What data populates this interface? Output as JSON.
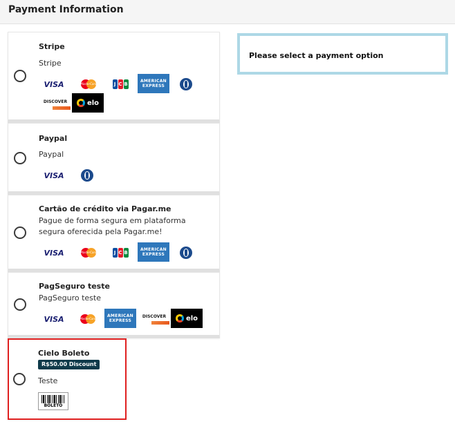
{
  "header": {
    "title": "Payment Information"
  },
  "selection_prompt": "Please select a payment option",
  "brands": {
    "visa": "VISA",
    "mastercard": "MasterCard",
    "jcb": [
      "J",
      "C",
      "B"
    ],
    "amex": [
      "AMERICAN",
      "EXPRESS"
    ],
    "discover": "DISCOVER",
    "elo": "elo",
    "boleto": "BOLETO"
  },
  "methods": [
    {
      "name": "Stripe",
      "description": "Stripe",
      "icons": [
        "visa-logo",
        "mastercard-logo",
        "jcb-logo",
        "amex-logo",
        "diners-logo",
        "discover-logo",
        "elo-logo"
      ],
      "selected": false
    },
    {
      "name": "Paypal",
      "description": "Paypal",
      "icons": [
        "visa-logo",
        "diners-logo"
      ],
      "selected": false
    },
    {
      "name": "Cartão de crédito via Pagar.me",
      "description_lines": [
        "Pague de forma segura em plataforma",
        "segura oferecida pela Pagar.me!"
      ],
      "icons": [
        "visa-logo",
        "mastercard-logo",
        "jcb-logo",
        "amex-logo",
        "diners-logo"
      ],
      "selected": false
    },
    {
      "name": "PagSeguro teste",
      "description": "PagSeguro teste",
      "icons": [
        "visa-logo",
        "mastercard-logo",
        "amex-logo",
        "discover-logo",
        "elo-logo"
      ],
      "selected": false
    },
    {
      "name": "Cielo Boleto",
      "badge": "R$50.00 Discount",
      "description": "Teste",
      "icons": [
        "boleto-logo"
      ],
      "selected": true
    }
  ],
  "colors": {
    "highlight_border": "#e02020",
    "badge_bg": "#0e3a4a",
    "prompt_border": "#add8e6",
    "visa": "#1a1f71",
    "amex": "#2e77bb"
  }
}
